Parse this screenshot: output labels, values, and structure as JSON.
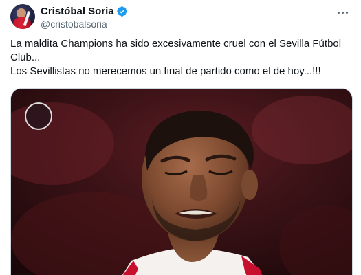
{
  "author": {
    "display_name": "Cristóbal Soria",
    "handle": "@cristobalsoria",
    "verified": true
  },
  "tweet": {
    "text": "La maldita Champions ha sido excesivamente cruel con el Sevilla Fútbol Club...\nLos Sevillistas no merecemos un final de partido como el de hoy...!!!"
  },
  "icons": {
    "verified": "verified-badge-icon",
    "more": "more-options-icon"
  },
  "colors": {
    "verified_blue": "#1d9bf0",
    "text_primary": "#0f1419",
    "text_secondary": "#536471",
    "kit_red": "#c8102e"
  }
}
